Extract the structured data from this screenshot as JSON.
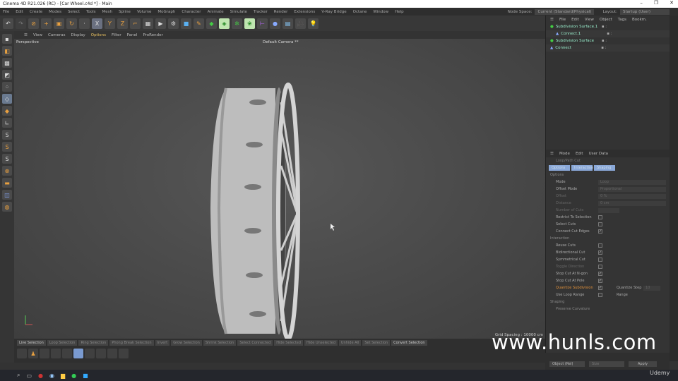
{
  "window": {
    "title": "Cinema 4D R21.026 (RC) - [Car Wheel.c4d *] - Main",
    "controls": [
      "–",
      "❐",
      "✕"
    ]
  },
  "menu": [
    "File",
    "Edit",
    "Create",
    "Modes",
    "Select",
    "Tools",
    "Mesh",
    "Spline",
    "Volume",
    "MoGraph",
    "Character",
    "Animate",
    "Simulate",
    "Tracker",
    "Render",
    "Extensions",
    "V-Ray Bridge",
    "Octane",
    "Window",
    "Help"
  ],
  "node_space": {
    "label": "Node Space:",
    "value": "Current (Standard/Physical)"
  },
  "layout": {
    "label": "Layout:",
    "value": "Startup (User)"
  },
  "viewport_menu": [
    "View",
    "Cameras",
    "Display",
    "Options",
    "Filter",
    "Panel",
    "ProRender"
  ],
  "viewport": {
    "name": "Perspective",
    "camera": "Default Camera **",
    "grid_spacing": "Grid Spacing : 10000 cm"
  },
  "object_manager": {
    "menu": [
      "File",
      "Edit",
      "View",
      "Object",
      "Tags",
      "Bookm."
    ],
    "objects": [
      {
        "name": "Subdivision Surface.1"
      },
      {
        "name": "Connect.1"
      },
      {
        "name": "Subdivision Surface"
      },
      {
        "name": "Connect"
      }
    ]
  },
  "attributes": {
    "menu": [
      "Mode",
      "Edit",
      "User Data"
    ],
    "tool": "Loop/Path Cut",
    "tabs": [
      "Options",
      "Interaction",
      "Shaping"
    ],
    "options_label": "Options",
    "mode": {
      "label": "Mode",
      "value": "Loop"
    },
    "offset_mode": {
      "label": "Offset Mode",
      "value": "Proportional"
    },
    "offset": {
      "label": "Offset",
      "value": "0 %"
    },
    "distance": {
      "label": "Distance",
      "value": "0 cm"
    },
    "number_of_cuts": "Number of Cuts",
    "restrict": "Restrict To Selection",
    "select_cuts": "Select Cuts",
    "connect_cut_edges": "Connect Cut Edges",
    "interaction_label": "Interaction",
    "reuse_cuts": "Reuse Cuts",
    "bidirectional_cut": "Bidirectional Cut",
    "symmetrical_cut": "Symmetrical Cut",
    "toggle_direction": "Toggle Direction",
    "stop_cut_ngon": "Stop Cut At N-gon",
    "stop_cut_pole": "Stop Cut At Pole",
    "quantize": "Quantize Subdivision",
    "quantize_step": "Quantize Step",
    "quantize_step_value": "10",
    "use_loop_range": "Use Loop Range",
    "range": "Range",
    "shaping_label": "Shaping",
    "preserve_curvature": "Preserve Curvature"
  },
  "coords": {
    "mode": "Object (Rel)",
    "size": "Size",
    "apply": "Apply"
  },
  "selection_tabs": [
    "Live Selection",
    "Loop Selection",
    "Ring Selection",
    "Phong Break Selection",
    "Invert",
    "Grow Selection",
    "Shrink Selection",
    "Select Connected",
    "Hide Selected",
    "Hide Unselected",
    "Unhide All",
    "Set Selection",
    "Convert Selection"
  ],
  "watermark": "www.hunls.com",
  "udemy": "Udemy"
}
